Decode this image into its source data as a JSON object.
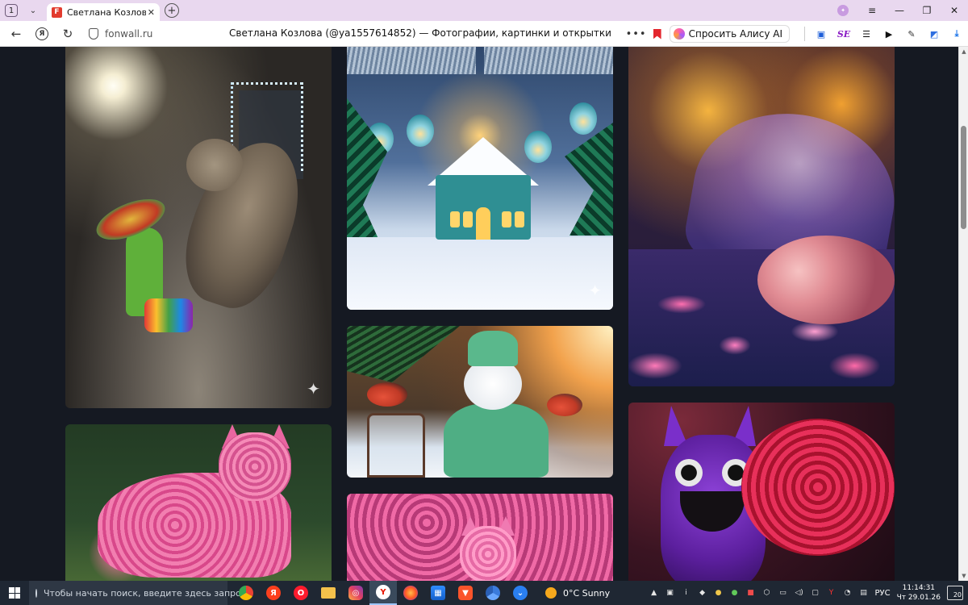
{
  "tabbar": {
    "tab_count": "1",
    "tab_title": "Светлана Козлова (@ya1557614852) — Фотографии, картинки и открытки",
    "favicon_letter": "F"
  },
  "addressbar": {
    "domain": "fonwall.ru",
    "page_title": "Светлана Козлова (@ya1557614852) — Фотографии, картинки и открытки",
    "alice_label": "Спросить Алису AI",
    "ext_labels": [
      "SE"
    ]
  },
  "gallery": {
    "cards": [
      {
        "name": "cat-cactus-image"
      },
      {
        "name": "gingerbread-house-image"
      },
      {
        "name": "umbrella-roses-image"
      },
      {
        "name": "snowman-bullfinch-image"
      },
      {
        "name": "rose-cat-image"
      },
      {
        "name": "pink-cat-roses-image"
      },
      {
        "name": "purple-cat-bouquet-image"
      }
    ]
  },
  "taskbar": {
    "search_placeholder": "Чтобы начать поиск, введите здесь запрос",
    "weather": "0°C  Sunny",
    "language": "РУС",
    "time": "11:14:31",
    "date": "Чт 29.01.26",
    "notifications": "20"
  },
  "colors": {
    "tab_bar": "#e9d8ef",
    "content_bg": "#151922",
    "taskbar_bg": "#1f2733",
    "bookmark": "#e3262d"
  }
}
